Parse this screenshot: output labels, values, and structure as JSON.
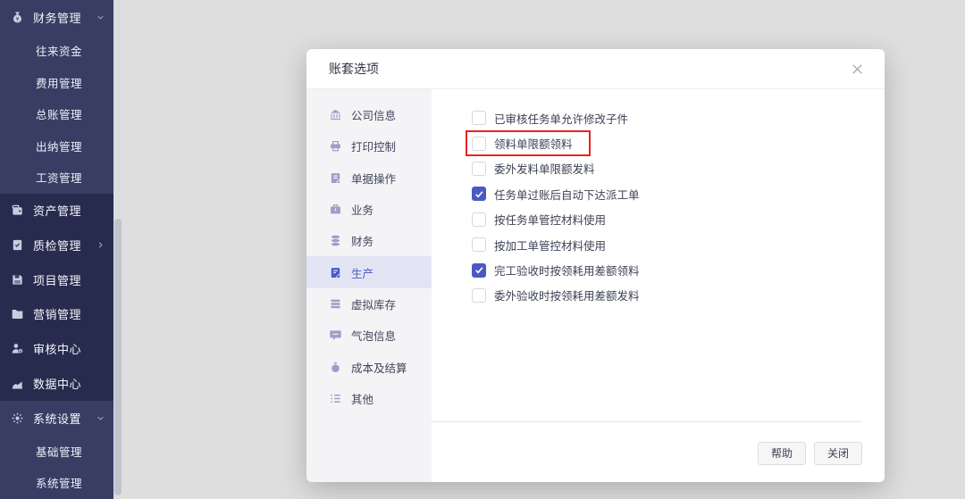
{
  "colors": {
    "accent": "#4a5ac4",
    "highlight_red": "#e8221f",
    "sidebar_bg": "#272c4f",
    "sidebar_group_bg": "#383e63"
  },
  "sidebar": {
    "items": [
      {
        "label": "财务管理",
        "type": "parent",
        "icon": "money-bag-icon",
        "chevron": "down"
      },
      {
        "label": "往来资金",
        "type": "child"
      },
      {
        "label": "费用管理",
        "type": "child"
      },
      {
        "label": "总账管理",
        "type": "child"
      },
      {
        "label": "出纳管理",
        "type": "child"
      },
      {
        "label": "工资管理",
        "type": "child"
      },
      {
        "label": "资产管理",
        "type": "parent",
        "icon": "assets-icon"
      },
      {
        "label": "质检管理",
        "type": "parent",
        "icon": "quality-icon",
        "chevron": "right"
      },
      {
        "label": "项目管理",
        "type": "parent",
        "icon": "project-icon"
      },
      {
        "label": "营销管理",
        "type": "parent",
        "icon": "folder-icon"
      },
      {
        "label": "审核中心",
        "type": "parent",
        "icon": "audit-icon"
      },
      {
        "label": "数据中心",
        "type": "parent",
        "icon": "chart-icon"
      },
      {
        "label": "系统设置",
        "type": "parent",
        "icon": "gear-icon",
        "chevron": "down"
      },
      {
        "label": "基础管理",
        "type": "child"
      },
      {
        "label": "系统管理",
        "type": "child"
      }
    ]
  },
  "modal": {
    "title": "账套选项",
    "close_icon": "close-icon",
    "nav": {
      "active_index": 5,
      "items": [
        {
          "label": "公司信息",
          "icon": "bank-icon"
        },
        {
          "label": "打印控制",
          "icon": "printer-icon"
        },
        {
          "label": "单据操作",
          "icon": "document-icon"
        },
        {
          "label": "业务",
          "icon": "briefcase-icon"
        },
        {
          "label": "财务",
          "icon": "database-icon"
        },
        {
          "label": "生产",
          "icon": "production-icon"
        },
        {
          "label": "虚拟库存",
          "icon": "inventory-icon"
        },
        {
          "label": "气泡信息",
          "icon": "bubble-icon"
        },
        {
          "label": "成本及结算",
          "icon": "cost-icon"
        },
        {
          "label": "其他",
          "icon": "list-icon"
        }
      ]
    },
    "checkboxes": [
      {
        "label": "已审核任务单允许修改子件",
        "checked": false
      },
      {
        "label": "领料单限额领料",
        "checked": false,
        "highlighted": true
      },
      {
        "label": "委外发料单限额发料",
        "checked": false
      },
      {
        "label": "任务单过账后自动下达派工单",
        "checked": true
      },
      {
        "label": "按任务单管控材料使用",
        "checked": false
      },
      {
        "label": "按加工单管控材料使用",
        "checked": false
      },
      {
        "label": "完工验收时按领耗用差额领料",
        "checked": true
      },
      {
        "label": "委外验收时按领耗用差额发料",
        "checked": false
      }
    ],
    "footer": {
      "help_label": "帮助",
      "close_label": "关闭"
    }
  }
}
